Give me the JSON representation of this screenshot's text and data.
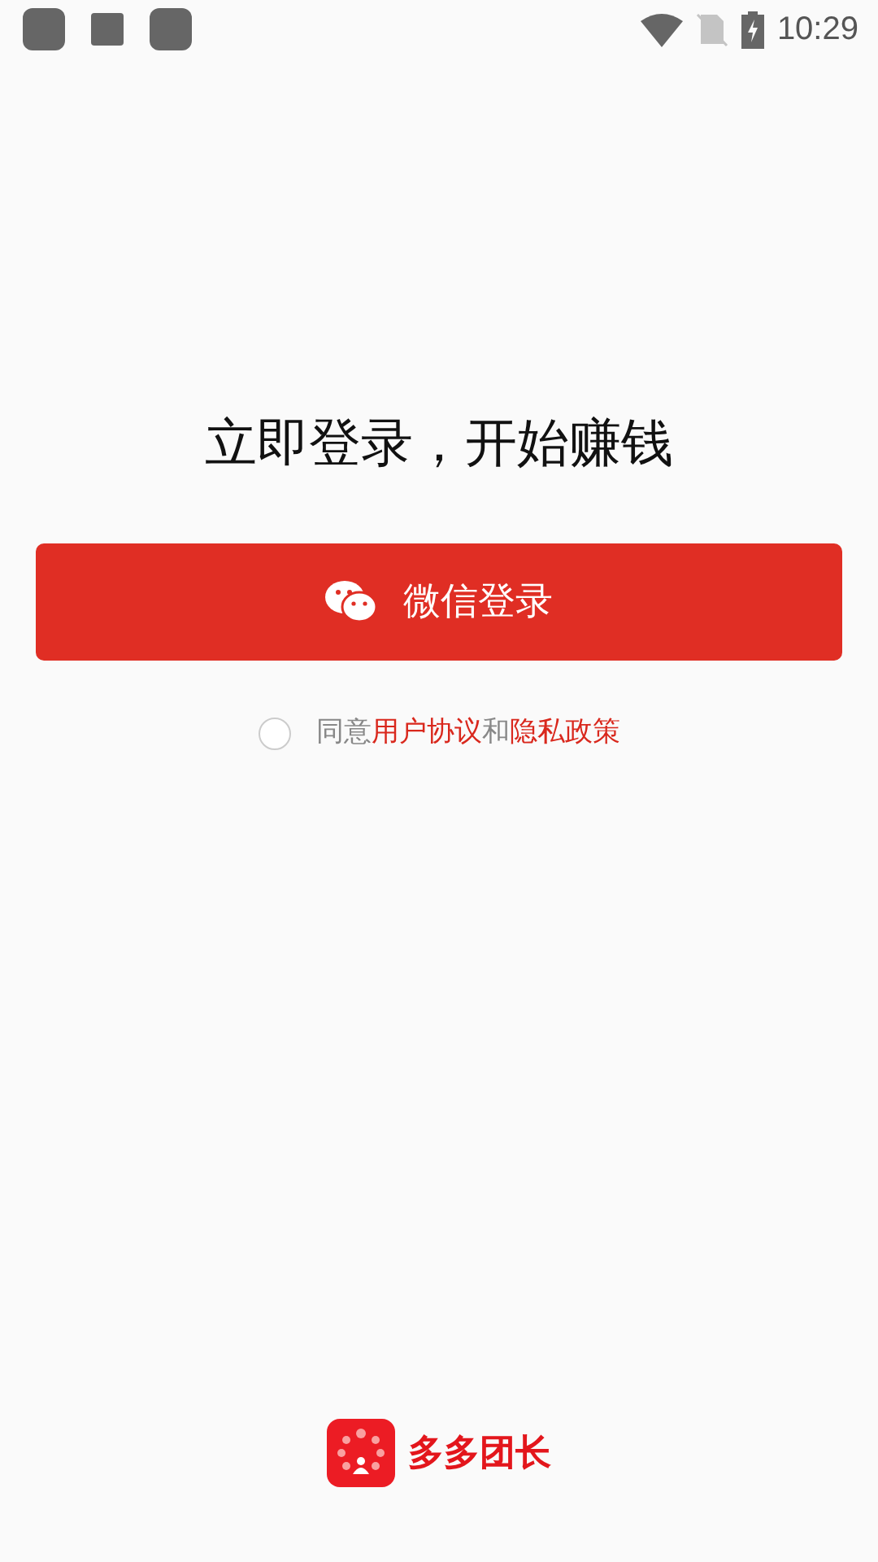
{
  "status_bar": {
    "time": "10:29"
  },
  "title": "立即登录，开始赚钱",
  "login_button": {
    "label": "微信登录"
  },
  "agreement": {
    "checked": false,
    "parts": [
      {
        "kind": "plain",
        "text": "同意"
      },
      {
        "kind": "link",
        "text": "用户协议"
      },
      {
        "kind": "plain",
        "text": "和"
      },
      {
        "kind": "link",
        "text": "隐私政策"
      }
    ]
  },
  "brand": {
    "name": "多多团长"
  }
}
